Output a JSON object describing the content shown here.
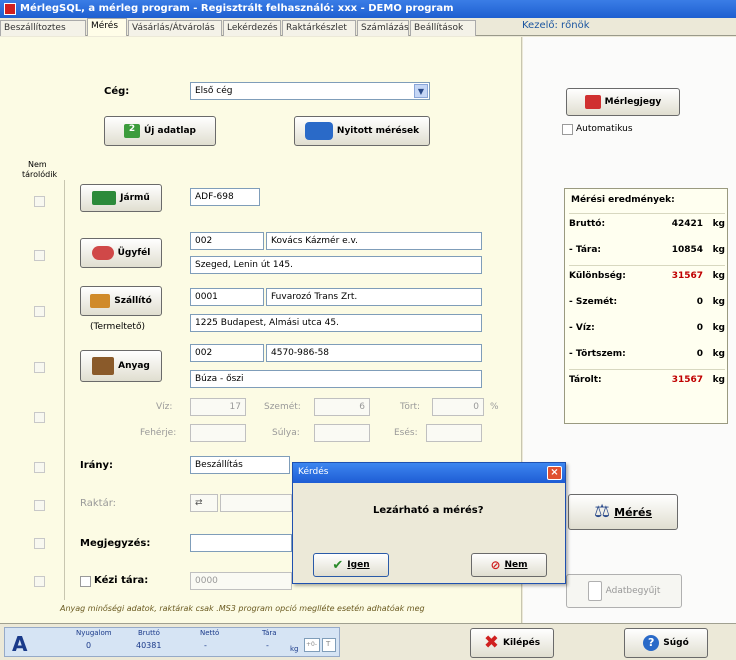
{
  "window": {
    "title": "MérlegSQL, a mérleg program - Regisztrált felhasználó: xxx - DEMO program"
  },
  "tabs": [
    {
      "label": "Beszállítoztes"
    },
    {
      "label": "Mérés"
    },
    {
      "label": "Vásárlás/Átvárolás"
    },
    {
      "label": "Lekérdezés"
    },
    {
      "label": "Raktárkészlet"
    },
    {
      "label": "Számlázás"
    },
    {
      "label": "Beállítások"
    }
  ],
  "operator": "Kezelő: rőnök",
  "header": {
    "company_label": "Cég:",
    "company_value": "Első cég",
    "new_sheet_button": "Új adatlap",
    "open_measurements_button": "Nyitott mérések",
    "not_stored_label_line1": "Nem",
    "not_stored_label_line2": "tárolódik"
  },
  "vehicle": {
    "button": "Jármű",
    "plate": "ADF-698"
  },
  "client": {
    "button": "Ügyfél",
    "code": "002",
    "name": "Kovács Kázmér e.v.",
    "address": "Szeged, Lenin út 145."
  },
  "carrier": {
    "button": "Szállító",
    "sublabel": "(Termeltető)",
    "code": "0001",
    "name": "Fuvarozó Trans Zrt.",
    "address": "1225 Budapest, Almási utca 45."
  },
  "material": {
    "button": "Anyag",
    "code": "002",
    "number": "4570-986-58",
    "name": "Búza - őszi"
  },
  "quality": {
    "water_label": "Víz:",
    "water_value": "17",
    "impurity_label": "Szemét:",
    "impurity_value": "6",
    "broken_label": "Tört:",
    "broken_value": "0",
    "unit": "%",
    "protein_label": "Fehérje:",
    "hl_label": "Súlya:",
    "fall_label": "Esés:"
  },
  "direction": {
    "label": "Irány:",
    "value": "Beszállítás"
  },
  "warehouse": {
    "label": "Raktár:"
  },
  "note": {
    "label": "Megjegyzés:"
  },
  "manual_tare": {
    "label": "Kézi tára:",
    "value": "0000"
  },
  "footnote": "Anyag minőségi adatok, raktárak csak .MS3 program opció meglléte esetén adhatóak meg",
  "right": {
    "weighbill_button": "Mérlegjegy",
    "automatic_label": "Automatikus",
    "results_title": "Mérési eredmények:",
    "rows": [
      {
        "label": "Bruttó:",
        "value": "42421",
        "unit": "kg",
        "red": false
      },
      {
        "label": "- Tára:",
        "value": "10854",
        "unit": "kg",
        "red": false
      },
      {
        "label": "Különbség:",
        "value": "31567",
        "unit": "kg",
        "red": true
      },
      {
        "label": "- Szemét:",
        "value": "0",
        "unit": "kg",
        "red": false
      },
      {
        "label": "- Víz:",
        "value": "0",
        "unit": "kg",
        "red": false
      },
      {
        "label": "- Törtszem:",
        "value": "0",
        "unit": "kg",
        "red": false
      },
      {
        "label": "Tárolt:",
        "value": "31567",
        "unit": "kg",
        "red": true
      }
    ],
    "measure_button": "Mérés",
    "data_transfer_button": "Adatbegyűjt"
  },
  "status": {
    "indicator": "A",
    "calm_label": "Nyugalom",
    "calm_value": "0",
    "brutto_label": "Bruttó",
    "brutto_value": "40381",
    "netto_label": "Nettó",
    "netto_value": "-",
    "tara_label": "Tára",
    "tara_value": "-",
    "unit": "kg",
    "small1": "+0-",
    "small2": "T",
    "exit_button": "Kilépés",
    "help_button": "Súgó"
  },
  "dialog": {
    "title": "Kérdés",
    "message": "Lezárható a mérés?",
    "yes_button": "Igen",
    "no_button": "Nem"
  },
  "colors": {
    "accent": "#1e5fd0",
    "red_value": "#c00000",
    "field_border": "#7f9db9"
  }
}
